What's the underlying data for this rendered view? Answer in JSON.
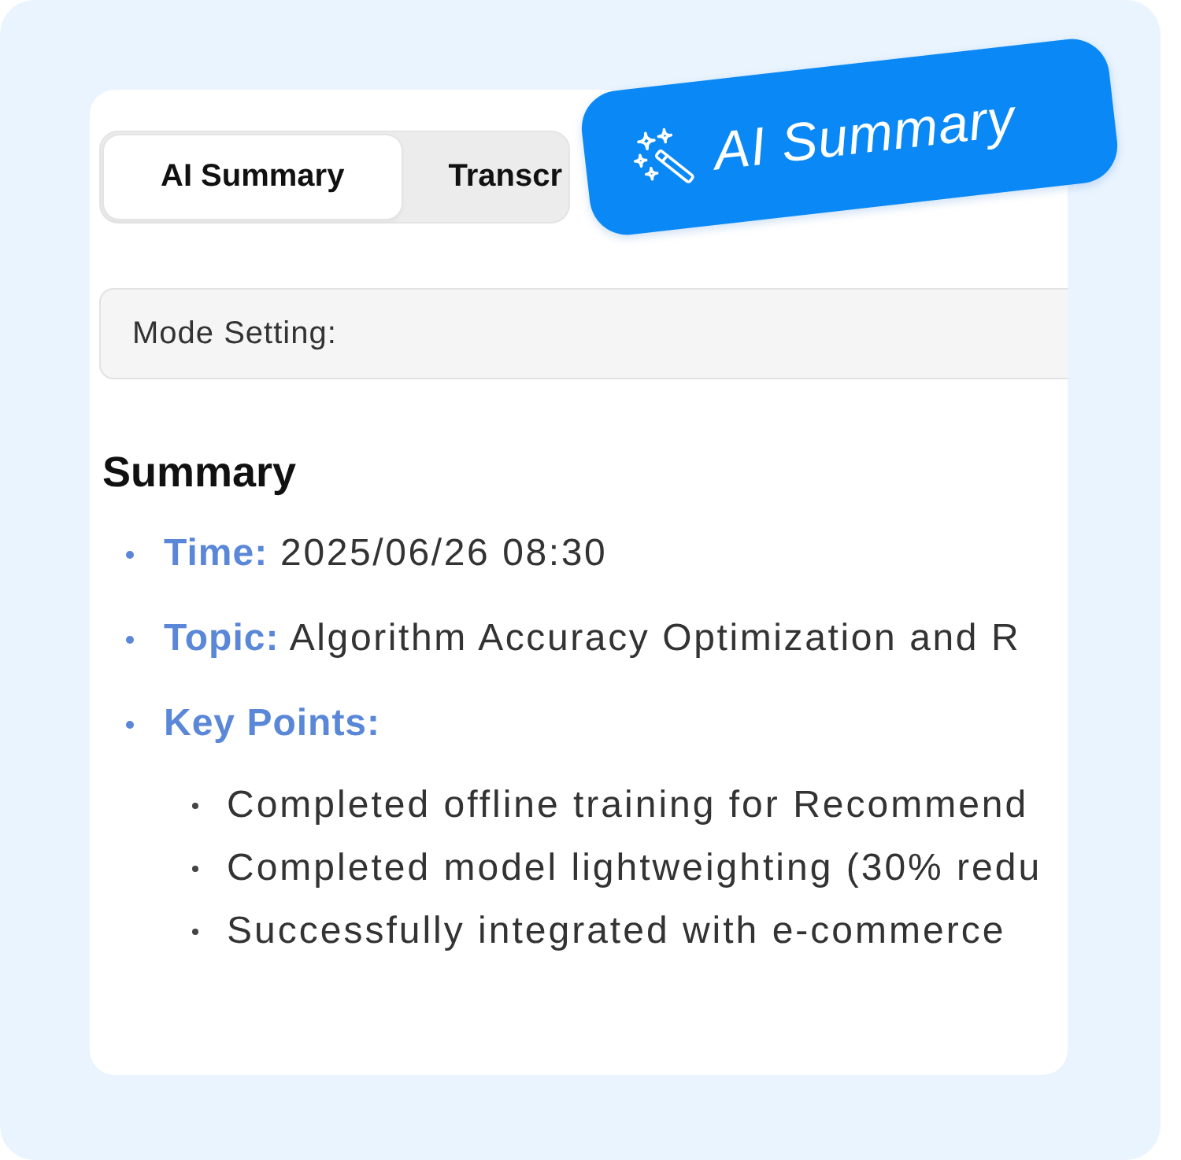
{
  "tabs": [
    {
      "label": "AI Summary",
      "selected": true
    },
    {
      "label": "Transcr",
      "selected": false
    }
  ],
  "badge": {
    "label": "AI Summary"
  },
  "mode_setting": {
    "label": "Mode Setting:"
  },
  "summary": {
    "title": "Summary",
    "items": [
      {
        "label": "Time:",
        "value": "2025/06/26 08:30"
      },
      {
        "label": "Topic:",
        "value": "Algorithm Accuracy Optimization and R"
      },
      {
        "label": "Key Points:",
        "children": [
          "Completed offline training for Recommend",
          "Completed model lightweighting (30% redu",
          "Successfully integrated with e-commerce"
        ]
      }
    ]
  }
}
